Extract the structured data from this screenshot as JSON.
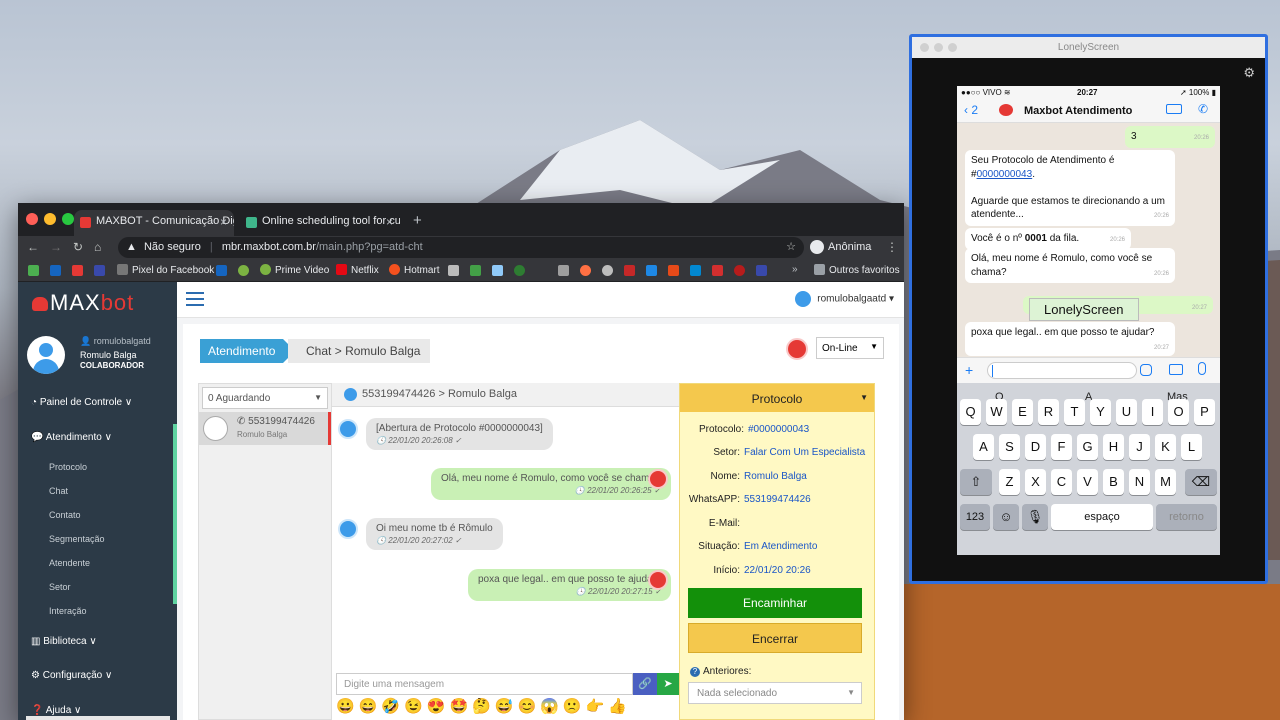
{
  "browser": {
    "tabs": [
      {
        "title": "MAXBOT - Comunicação Digit",
        "active": true
      },
      {
        "title": "Online scheduling tool for cus",
        "active": false
      }
    ],
    "security_label": "Não seguro",
    "url_host": "mbr.maxbot.com.br",
    "url_path": "/main.php?pg=atd-cht",
    "profile_label": "Anônima",
    "bookmarks": [
      "Pixel do Facebook",
      "Prime Video",
      "Netflix",
      "Hotmart",
      "Outros favoritos"
    ]
  },
  "sidebar": {
    "brand": {
      "max": "MAX",
      "bot": "bot"
    },
    "user": {
      "login": "romulobalgatd",
      "name": "Romulo Balga",
      "role": "COLABORADOR"
    },
    "nav": [
      {
        "label": "Painel de Controle",
        "caret": "∨"
      },
      {
        "label": "Atendimento",
        "caret": "∨"
      },
      {
        "label": "Biblioteca",
        "caret": "∨"
      },
      {
        "label": "Configuração",
        "caret": "∨"
      },
      {
        "label": "Ajuda",
        "caret": "∨"
      }
    ],
    "subnav": [
      "Protocolo",
      "Chat",
      "Contato",
      "Segmentação",
      "Atendente",
      "Setor",
      "Interação"
    ]
  },
  "topbar": {
    "user": "romulobalgaatd"
  },
  "breadcrumb": {
    "section": "Atendimento",
    "page": "Chat",
    "separator": ">",
    "contact": "Romulo Balga"
  },
  "status": {
    "selected": "On-Line"
  },
  "queue": {
    "filter": "0 Aguardando",
    "items": [
      {
        "number": "553199474426",
        "name": "Romulo Balga"
      }
    ]
  },
  "chat": {
    "header": "553199474426 > Romulo Balga",
    "messages": [
      {
        "dir": "in",
        "text": "[Abertura de Protocolo #0000000043]",
        "time": "22/01/20 20:26:08"
      },
      {
        "dir": "out",
        "text": "Olá, meu nome é Romulo, como você se chama?",
        "time": "22/01/20 20:26:25"
      },
      {
        "dir": "in",
        "text": "Oi meu nome tb é Rômulo",
        "time": "22/01/20 20:27:02"
      },
      {
        "dir": "out",
        "text": "poxa que legal.. em que posso te ajudar?",
        "time": "22/01/20 20:27:15"
      }
    ],
    "input_placeholder": "Digite uma mensagem",
    "emojis": [
      "😀",
      "😄",
      "🤣",
      "😉",
      "😍",
      "🤩",
      "🤔",
      "😅",
      "😊",
      "😱",
      "🙁",
      "👉",
      "👍"
    ]
  },
  "protocol": {
    "title": "Protocolo",
    "fields": [
      {
        "label": "Protocolo:",
        "value": "#0000000043"
      },
      {
        "label": "Setor:",
        "value": "Falar Com Um Especialista"
      },
      {
        "label": "Nome:",
        "value": "Romulo Balga"
      },
      {
        "label": "WhatsAPP:",
        "value": "553199474426"
      },
      {
        "label": "E-Mail:",
        "value": ""
      },
      {
        "label": "Situação:",
        "value": "Em Atendimento"
      },
      {
        "label": "Início:",
        "value": "22/01/20 20:26"
      }
    ],
    "forward_label": "Encaminhar",
    "close_label": "Encerrar",
    "previous_label": "Anteriores:",
    "previous_select": "Nada selecionado"
  },
  "lonely": {
    "title": "LonelyScreen",
    "overlay_label": "LonelyScreen",
    "phone": {
      "carrier": "VIVO",
      "clock": "20:27",
      "battery": "100%",
      "back_count": "2",
      "contact": "Maxbot Atendimento",
      "messages": [
        {
          "dir": "out",
          "text": "3",
          "time": "20:26"
        },
        {
          "dir": "in",
          "text_a": "Seu Protocolo de Atendimento é #",
          "link": "0000000043",
          "text_b": ".",
          "text_c": "Aguarde que estamos te direcionando a um atendente...",
          "time": "20:26"
        },
        {
          "dir": "in",
          "pre": "Você é o nº ",
          "bold": "0001",
          "post": " da fila.",
          "time": "20:26"
        },
        {
          "dir": "in",
          "text": "Olá, meu nome é Romulo, como você se chama?",
          "time": "20:26"
        },
        {
          "dir": "out",
          "text": "",
          "time": "20:27"
        },
        {
          "dir": "in",
          "text": "poxa que legal.. em que posso te ajudar?",
          "time": "20:27"
        }
      ],
      "suggestions": [
        "O",
        "A",
        "Mas"
      ],
      "rows": [
        [
          "Q",
          "W",
          "E",
          "R",
          "T",
          "Y",
          "U",
          "I",
          "O",
          "P"
        ],
        [
          "A",
          "S",
          "D",
          "F",
          "G",
          "H",
          "J",
          "K",
          "L"
        ],
        [
          "Z",
          "X",
          "C",
          "V",
          "B",
          "N",
          "M"
        ]
      ],
      "key_123": "123",
      "key_space": "espaço",
      "key_return": "retorno"
    }
  }
}
